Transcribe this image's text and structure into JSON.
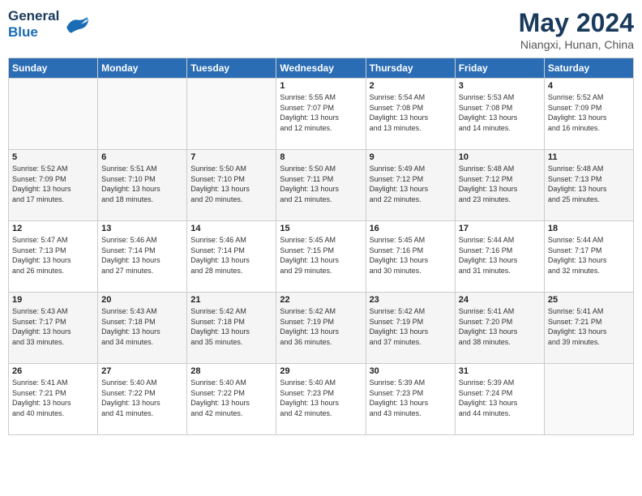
{
  "header": {
    "logo_line1": "General",
    "logo_line2": "Blue",
    "title": "May 2024",
    "subtitle": "Niangxi, Hunan, China"
  },
  "weekdays": [
    "Sunday",
    "Monday",
    "Tuesday",
    "Wednesday",
    "Thursday",
    "Friday",
    "Saturday"
  ],
  "weeks": [
    [
      {
        "day": "",
        "info": ""
      },
      {
        "day": "",
        "info": ""
      },
      {
        "day": "",
        "info": ""
      },
      {
        "day": "1",
        "info": "Sunrise: 5:55 AM\nSunset: 7:07 PM\nDaylight: 13 hours\nand 12 minutes."
      },
      {
        "day": "2",
        "info": "Sunrise: 5:54 AM\nSunset: 7:08 PM\nDaylight: 13 hours\nand 13 minutes."
      },
      {
        "day": "3",
        "info": "Sunrise: 5:53 AM\nSunset: 7:08 PM\nDaylight: 13 hours\nand 14 minutes."
      },
      {
        "day": "4",
        "info": "Sunrise: 5:52 AM\nSunset: 7:09 PM\nDaylight: 13 hours\nand 16 minutes."
      }
    ],
    [
      {
        "day": "5",
        "info": "Sunrise: 5:52 AM\nSunset: 7:09 PM\nDaylight: 13 hours\nand 17 minutes."
      },
      {
        "day": "6",
        "info": "Sunrise: 5:51 AM\nSunset: 7:10 PM\nDaylight: 13 hours\nand 18 minutes."
      },
      {
        "day": "7",
        "info": "Sunrise: 5:50 AM\nSunset: 7:10 PM\nDaylight: 13 hours\nand 20 minutes."
      },
      {
        "day": "8",
        "info": "Sunrise: 5:50 AM\nSunset: 7:11 PM\nDaylight: 13 hours\nand 21 minutes."
      },
      {
        "day": "9",
        "info": "Sunrise: 5:49 AM\nSunset: 7:12 PM\nDaylight: 13 hours\nand 22 minutes."
      },
      {
        "day": "10",
        "info": "Sunrise: 5:48 AM\nSunset: 7:12 PM\nDaylight: 13 hours\nand 23 minutes."
      },
      {
        "day": "11",
        "info": "Sunrise: 5:48 AM\nSunset: 7:13 PM\nDaylight: 13 hours\nand 25 minutes."
      }
    ],
    [
      {
        "day": "12",
        "info": "Sunrise: 5:47 AM\nSunset: 7:13 PM\nDaylight: 13 hours\nand 26 minutes."
      },
      {
        "day": "13",
        "info": "Sunrise: 5:46 AM\nSunset: 7:14 PM\nDaylight: 13 hours\nand 27 minutes."
      },
      {
        "day": "14",
        "info": "Sunrise: 5:46 AM\nSunset: 7:14 PM\nDaylight: 13 hours\nand 28 minutes."
      },
      {
        "day": "15",
        "info": "Sunrise: 5:45 AM\nSunset: 7:15 PM\nDaylight: 13 hours\nand 29 minutes."
      },
      {
        "day": "16",
        "info": "Sunrise: 5:45 AM\nSunset: 7:16 PM\nDaylight: 13 hours\nand 30 minutes."
      },
      {
        "day": "17",
        "info": "Sunrise: 5:44 AM\nSunset: 7:16 PM\nDaylight: 13 hours\nand 31 minutes."
      },
      {
        "day": "18",
        "info": "Sunrise: 5:44 AM\nSunset: 7:17 PM\nDaylight: 13 hours\nand 32 minutes."
      }
    ],
    [
      {
        "day": "19",
        "info": "Sunrise: 5:43 AM\nSunset: 7:17 PM\nDaylight: 13 hours\nand 33 minutes."
      },
      {
        "day": "20",
        "info": "Sunrise: 5:43 AM\nSunset: 7:18 PM\nDaylight: 13 hours\nand 34 minutes."
      },
      {
        "day": "21",
        "info": "Sunrise: 5:42 AM\nSunset: 7:18 PM\nDaylight: 13 hours\nand 35 minutes."
      },
      {
        "day": "22",
        "info": "Sunrise: 5:42 AM\nSunset: 7:19 PM\nDaylight: 13 hours\nand 36 minutes."
      },
      {
        "day": "23",
        "info": "Sunrise: 5:42 AM\nSunset: 7:19 PM\nDaylight: 13 hours\nand 37 minutes."
      },
      {
        "day": "24",
        "info": "Sunrise: 5:41 AM\nSunset: 7:20 PM\nDaylight: 13 hours\nand 38 minutes."
      },
      {
        "day": "25",
        "info": "Sunrise: 5:41 AM\nSunset: 7:21 PM\nDaylight: 13 hours\nand 39 minutes."
      }
    ],
    [
      {
        "day": "26",
        "info": "Sunrise: 5:41 AM\nSunset: 7:21 PM\nDaylight: 13 hours\nand 40 minutes."
      },
      {
        "day": "27",
        "info": "Sunrise: 5:40 AM\nSunset: 7:22 PM\nDaylight: 13 hours\nand 41 minutes."
      },
      {
        "day": "28",
        "info": "Sunrise: 5:40 AM\nSunset: 7:22 PM\nDaylight: 13 hours\nand 42 minutes."
      },
      {
        "day": "29",
        "info": "Sunrise: 5:40 AM\nSunset: 7:23 PM\nDaylight: 13 hours\nand 42 minutes."
      },
      {
        "day": "30",
        "info": "Sunrise: 5:39 AM\nSunset: 7:23 PM\nDaylight: 13 hours\nand 43 minutes."
      },
      {
        "day": "31",
        "info": "Sunrise: 5:39 AM\nSunset: 7:24 PM\nDaylight: 13 hours\nand 44 minutes."
      },
      {
        "day": "",
        "info": ""
      }
    ]
  ]
}
